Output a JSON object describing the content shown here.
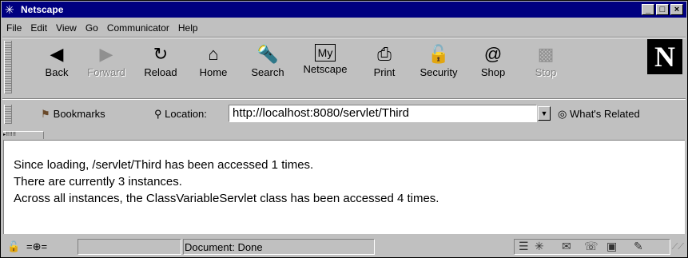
{
  "window": {
    "title": "Netscape",
    "controls": [
      "_",
      "□",
      "×"
    ]
  },
  "menu": [
    "File",
    "Edit",
    "View",
    "Go",
    "Communicator",
    "Help"
  ],
  "toolbar": {
    "buttons": [
      {
        "label": "Back",
        "icon": "back-arrow-icon",
        "enabled": true
      },
      {
        "label": "Forward",
        "icon": "forward-arrow-icon",
        "enabled": false
      },
      {
        "label": "Reload",
        "icon": "reload-icon",
        "enabled": true
      },
      {
        "label": "Home",
        "icon": "home-icon",
        "enabled": true
      },
      {
        "label": "Search",
        "icon": "search-icon",
        "enabled": true
      },
      {
        "label": "Netscape",
        "icon": "netscape-icon",
        "enabled": true
      },
      {
        "label": "Print",
        "icon": "print-icon",
        "enabled": true
      },
      {
        "label": "Security",
        "icon": "security-lock-icon",
        "enabled": true
      },
      {
        "label": "Shop",
        "icon": "shop-icon",
        "enabled": true
      },
      {
        "label": "Stop",
        "icon": "stop-icon",
        "enabled": false
      }
    ],
    "logo": "N"
  },
  "location": {
    "bookmarks_label": "Bookmarks",
    "location_label": "Location:",
    "url": "http://localhost:8080/servlet/Third",
    "related_label": "What's Related"
  },
  "content": {
    "lines": [
      "Since loading,  /servlet/Third  has been accessed 1 times.",
      "There are currently 3 instances.",
      "Across all instances, the ClassVariableServlet class has been accessed 4 times."
    ]
  },
  "status": {
    "text": "Document: Done"
  },
  "colors": {
    "titlebar": "#000080",
    "chrome": "#c0c0c0"
  }
}
